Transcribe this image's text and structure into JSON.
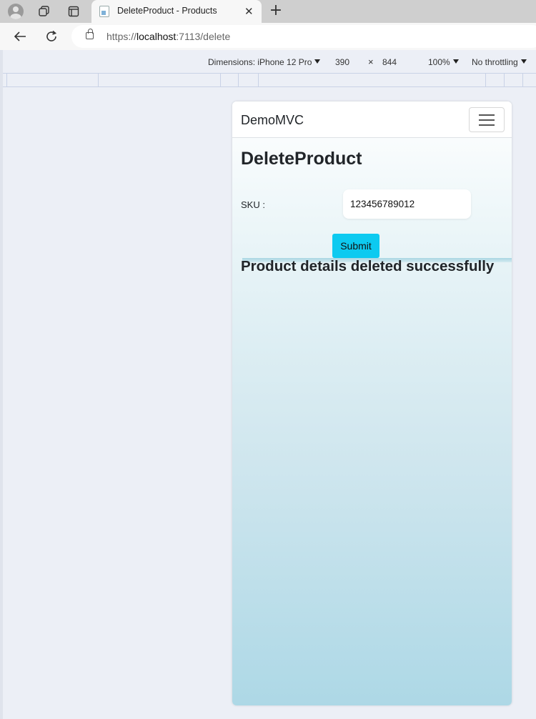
{
  "browser": {
    "tab_title": "DeleteProduct - Products",
    "url_prefix": "https://",
    "url_host": "localhost",
    "url_path": ":7113/delete"
  },
  "devtools": {
    "dimensions_label": "Dimensions: iPhone 12 Pro",
    "width": "390",
    "times": "×",
    "height": "844",
    "zoom": "100%",
    "throttling": "No throttling"
  },
  "page": {
    "brand": "DemoMVC",
    "heading": "DeleteProduct",
    "sku_label": "SKU :",
    "sku_value": "123456789012",
    "submit_label": "Submit",
    "message": "Product details deleted successfully"
  },
  "colors": {
    "submit_button": "#0dcaf0",
    "page_gradient_bottom": "#add8e6"
  },
  "icons": {
    "profile": "avatar-icon",
    "workspaces": "workspaces-icon",
    "tab_actions": "tab-actions-icon",
    "favicon": "page-favicon-icon",
    "close_tab": "close-icon",
    "new_tab": "plus-icon",
    "back": "back-arrow-icon",
    "reload": "reload-icon",
    "lock": "lock-icon",
    "menu": "hamburger-icon"
  }
}
